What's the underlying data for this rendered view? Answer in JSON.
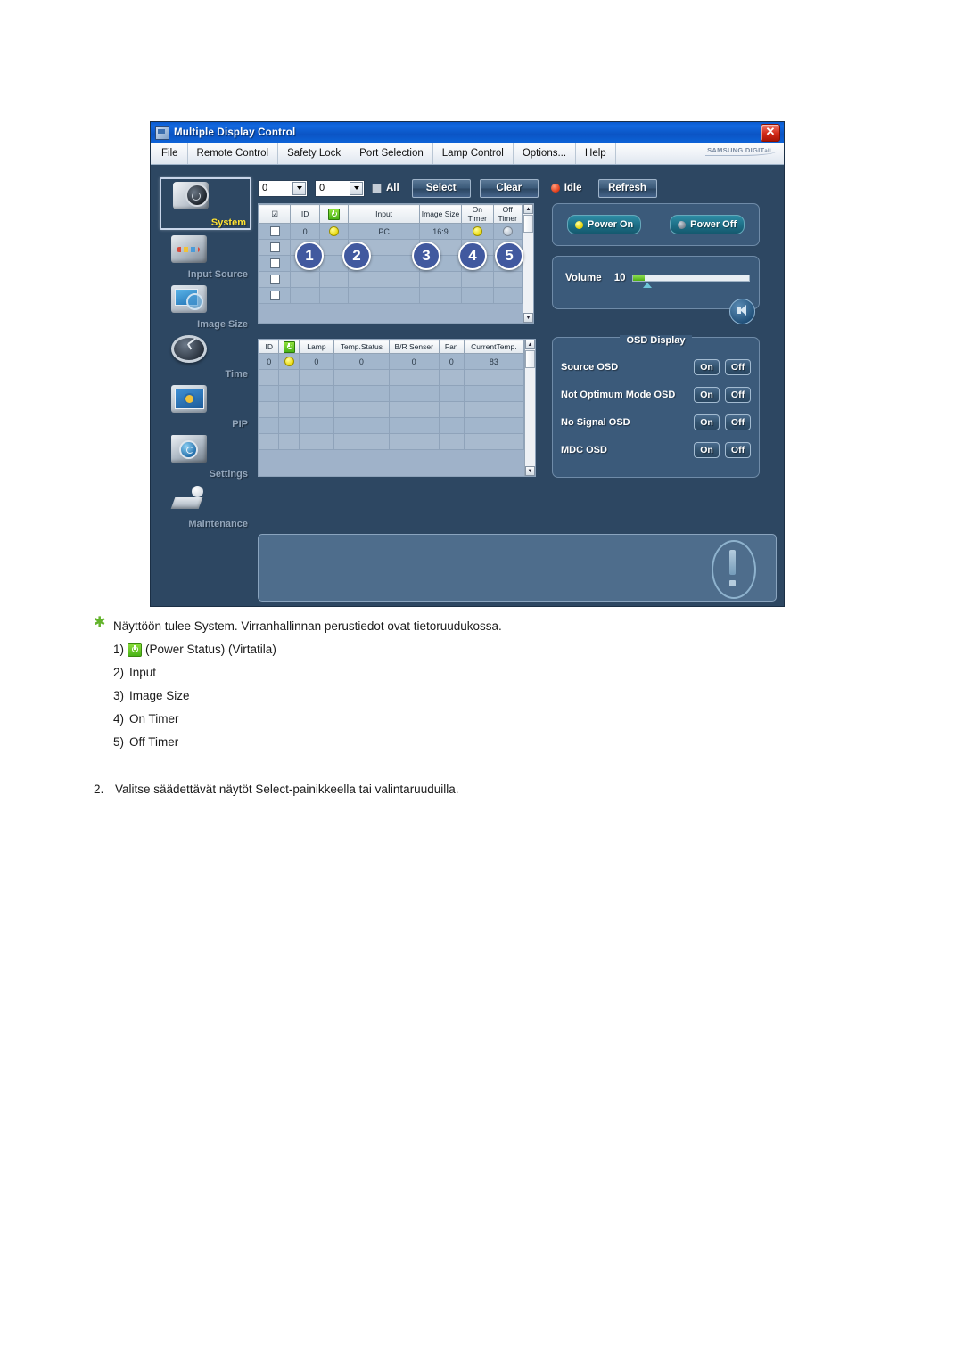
{
  "window": {
    "title": "Multiple Display Control",
    "close_label": "✕",
    "brand": "SAMSUNG DIGIT",
    "brand_suffix": "all",
    "menu": [
      "File",
      "Remote Control",
      "Safety Lock",
      "Port Selection",
      "Lamp Control",
      "Options...",
      "Help"
    ]
  },
  "sidebar": {
    "items": [
      {
        "label": "System",
        "icon": "system-icon",
        "active": true
      },
      {
        "label": "Input Source",
        "icon": "input-source-icon",
        "active": false
      },
      {
        "label": "Image Size",
        "icon": "image-size-icon",
        "active": false
      },
      {
        "label": "Time",
        "icon": "time-icon",
        "active": false
      },
      {
        "label": "PIP",
        "icon": "pip-icon",
        "active": false
      },
      {
        "label": "Settings",
        "icon": "settings-icon",
        "active": false
      },
      {
        "label": "Maintenance",
        "icon": "maintenance-icon",
        "active": false
      }
    ]
  },
  "toolbar": {
    "id_from": "0",
    "id_to": "0",
    "all_label": "All",
    "select_label": "Select",
    "clear_label": "Clear",
    "status_label": "Idle",
    "status_color": "#e03a16",
    "refresh_label": "Refresh"
  },
  "display_table": {
    "headers": [
      "",
      "ID",
      "power-status-icon",
      "Input",
      "Image Size",
      "On Timer",
      "Off Timer"
    ],
    "rows": [
      {
        "id": "0",
        "power": "on",
        "input": "PC",
        "image_size": "16:9",
        "on_timer": "on",
        "off_timer": "off"
      }
    ],
    "empty_rows": 4
  },
  "lamp_table": {
    "headers": [
      "ID",
      "power-status-icon",
      "Lamp",
      "Temp.Status",
      "B/R Senser",
      "Fan",
      "CurrentTemp."
    ],
    "rows": [
      {
        "id": "0",
        "power": "on",
        "lamp": "0",
        "temp_status": "0",
        "br_senser": "0",
        "fan": "0",
        "current_temp": "83"
      }
    ],
    "empty_rows": 5
  },
  "callouts": [
    "1",
    "2",
    "3",
    "4",
    "5"
  ],
  "power_panel": {
    "power_on_label": "Power On",
    "power_off_label": "Power Off"
  },
  "volume_panel": {
    "label": "Volume",
    "value": "10",
    "percent": 10
  },
  "osd_panel": {
    "title": "OSD Display",
    "on_label": "On",
    "off_label": "Off",
    "rows": [
      "Source OSD",
      "Not Optimum Mode OSD",
      "No Signal OSD",
      "MDC OSD"
    ]
  },
  "document": {
    "note": "Näyttöön tulee System. Virranhallinnan perustiedot ovat tietoruudukossa.",
    "list": [
      {
        "num": "1)",
        "pre": "",
        "icon": "power-status-icon",
        "post": "(Power Status) (Virtatila)"
      },
      {
        "num": "2)",
        "pre": "Input",
        "icon": "",
        "post": ""
      },
      {
        "num": "3)",
        "pre": "Image Size",
        "icon": "",
        "post": ""
      },
      {
        "num": "4)",
        "pre": "On Timer",
        "icon": "",
        "post": ""
      },
      {
        "num": "5)",
        "pre": "Off Timer",
        "icon": "",
        "post": ""
      }
    ],
    "step2_num": "2.",
    "step2_text": "Valitse säädettävät näytöt Select-painikkeella tai valintaruuduilla."
  }
}
